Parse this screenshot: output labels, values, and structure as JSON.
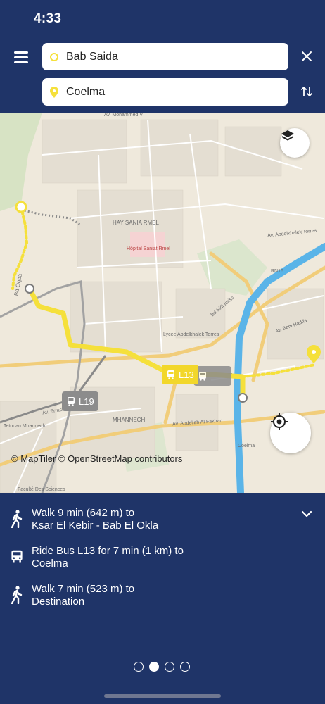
{
  "status": {
    "time": "4:33"
  },
  "search": {
    "origin": "Bab Saida",
    "destination": "Coelma"
  },
  "map": {
    "attribution": "© MapTiler © OpenStreetMap contributors",
    "bus_tags": [
      "L13",
      "L19"
    ],
    "labels": {
      "hay_sania": "HAY SANIA RMEL",
      "mhanech": "MHANNECH",
      "av_abdelah": "Av. Abdellah Al Fakhar",
      "coelma": "Coelma",
      "rn16": "RN16",
      "bd_oqba": "Bd Oqba",
      "av_mohammed_v": "Av. Mohammed V",
      "av_errachidia": "Av. Errachidia",
      "av_beni_hadifa": "Av. Beni Hadifa",
      "tetouan_mhannech": "Tetouan Mhannech",
      "lycee": "Lycée Abdelkhalek Torres",
      "hopital": "Hôpital Saniat Rmel",
      "bd_sidi_idriss": "Bd Sidi Idriss",
      "av_abdelkhalek": "Av. Abdelkhalek Torres",
      "faculte": "Faculté Des Sciences",
      "ksar": "Ksar El Kebir - Bab El Okla"
    }
  },
  "itinerary": {
    "steps": [
      {
        "icon": "walk-icon",
        "text_line1": "Walk 9 min (642 m) to",
        "text_line2": "Ksar El Kebir - Bab El Okla"
      },
      {
        "icon": "bus-icon",
        "text_line1": "Ride Bus L13 for 7 min (1 km) to",
        "text_line2": "Coelma"
      },
      {
        "icon": "walk-icon",
        "text_line1": "Walk 7 min (523 m) to",
        "text_line2": "Destination"
      }
    ],
    "pages": 4,
    "active_page": 2
  },
  "colors": {
    "header_bg": "#1f3468",
    "route_yellow": "#f5e03b",
    "river": "#5ab4e8",
    "map_bg": "#efe9dc"
  }
}
